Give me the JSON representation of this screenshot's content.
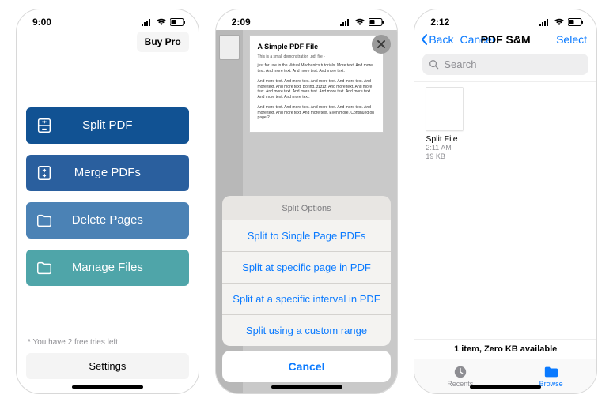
{
  "phone1": {
    "time": "9:00",
    "buy_pro": "Buy Pro",
    "buttons": {
      "split": "Split PDF",
      "merge": "Merge PDFs",
      "delete": "Delete Pages",
      "manage": "Manage Files"
    },
    "tries_note": "* You have 2 free tries left.",
    "settings": "Settings"
  },
  "phone2": {
    "time": "2:09",
    "doc": {
      "title": "A Simple PDF File",
      "subtitle": "This is a small demonstration .pdf file -",
      "p1": "just for use in the Virtual Mechanics tutorials. More text. And more text. And more text. And more text. And more text.",
      "p2": "And more text. And more text. And more text. And more text. And more text. And more text. Boring, zzzzz. And more text. And more text. And more text. And more text. And more text. And more text. And more text. And more text.",
      "p3": "And more text. And more text. And more text. And more text. And more text. And more text. And more text. Even more. Continued on page 2 ..."
    },
    "sheet": {
      "header": "Split Options",
      "opt1": "Split to Single Page PDFs",
      "opt2": "Split at specific page in PDF",
      "opt3": "Split at a specific interval in PDF",
      "opt4": "Split using a custom range",
      "cancel": "Cancel"
    }
  },
  "phone3": {
    "time": "2:12",
    "nav": {
      "back": "Back",
      "cancel": "Cancel",
      "title": "PDF S&M",
      "select": "Select"
    },
    "search_placeholder": "Search",
    "file": {
      "name": "Split File",
      "time": "2:11 AM",
      "size": "19 KB"
    },
    "storage": "1 item, Zero KB available",
    "tabs": {
      "recents": "Recents",
      "browse": "Browse"
    }
  }
}
